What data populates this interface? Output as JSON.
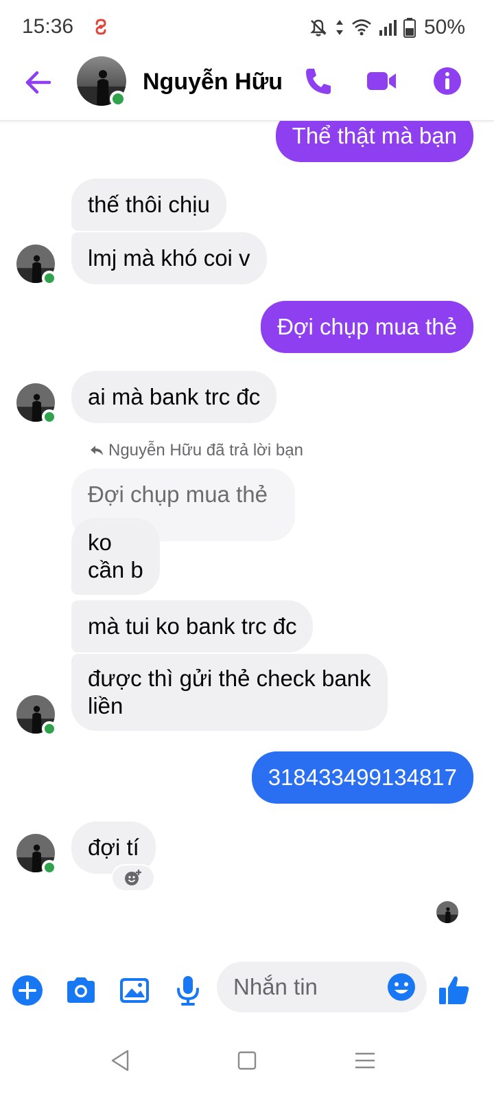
{
  "status_bar": {
    "time": "15:36",
    "battery": "50%",
    "icons": [
      "notifications-off-icon",
      "data-arrows-icon",
      "wifi-icon",
      "signal-icon",
      "battery-icon"
    ]
  },
  "header": {
    "contact_name": "Nguyễn Hữu",
    "online": true,
    "icons": [
      "back-arrow-icon",
      "phone-icon",
      "video-camera-icon",
      "info-icon"
    ]
  },
  "messages": [
    {
      "from": "me",
      "text": "Thể thật mà bạn",
      "color": "#8e3ff0"
    },
    {
      "from": "them",
      "text": "thế thôi chịu"
    },
    {
      "from": "them",
      "text": "lmj mà khó coi v"
    },
    {
      "from": "me",
      "text": "Đợi chụp mua thẻ",
      "color": "#8e3ff0"
    },
    {
      "from": "them",
      "text": "ai mà bank trc đc"
    },
    {
      "from": "them",
      "reply_note": "Nguyễn Hữu đã trả lời bạn",
      "quoted": "Đợi chụp mua thẻ",
      "line1": "ko",
      "line2": "cần b"
    },
    {
      "from": "them",
      "text": "mà tui ko bank trc đc"
    },
    {
      "from": "them",
      "line1": "được thì gửi thẻ check bank",
      "line2": "liền"
    },
    {
      "from": "me",
      "text": "318433499134817",
      "color": "#2a6ef2"
    },
    {
      "from": "them",
      "text": "đợi tí"
    }
  ],
  "composer": {
    "placeholder": "Nhắn tin",
    "icons": [
      "add-icon",
      "camera-icon",
      "gallery-icon",
      "microphone-icon",
      "emoji-icon",
      "thumbs-up-icon"
    ]
  },
  "colors": {
    "accent_purple": "#8e3ff0",
    "accent_blue": "#2a6ef2",
    "online_green": "#31a24c"
  }
}
